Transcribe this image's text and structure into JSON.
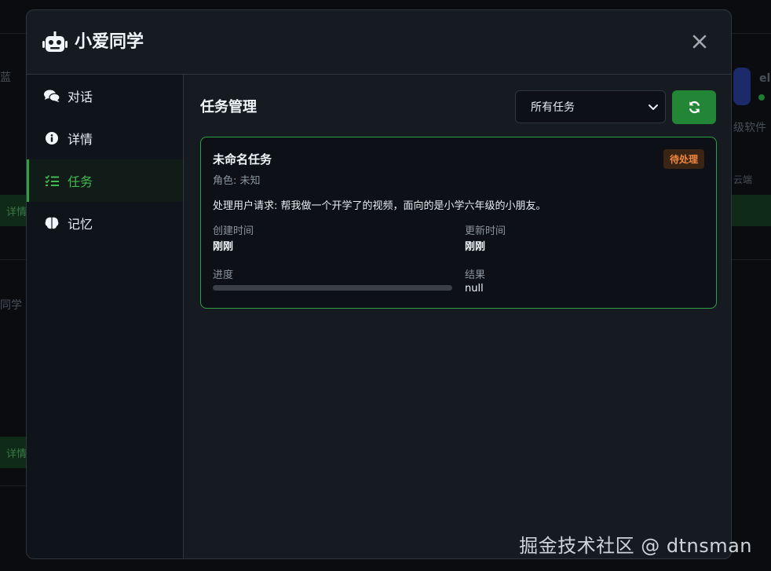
{
  "app": {
    "title": "小爱同学"
  },
  "sidebar": {
    "items": [
      {
        "label": "对话",
        "icon": "comments-icon",
        "active": false
      },
      {
        "label": "详情",
        "icon": "info-circle-icon",
        "active": false
      },
      {
        "label": "任务",
        "icon": "task-list-icon",
        "active": true
      },
      {
        "label": "记忆",
        "icon": "brain-icon",
        "active": false
      }
    ]
  },
  "tasks_panel": {
    "title": "任务管理",
    "filter": {
      "selected": "所有任务"
    },
    "refresh_icon": "refresh-icon",
    "cards": [
      {
        "name": "未命名任务",
        "role": "角色: 未知",
        "status": "待处理",
        "description": "处理用户请求: 帮我做一个开学了的视频，面向的是小学六年级的小朋友。",
        "created_label": "创建时间",
        "created_value": "刚刚",
        "updated_label": "更新时间",
        "updated_value": "刚刚",
        "progress_label": "进度",
        "progress_percent": 0,
        "result_label": "结果",
        "result_value": "null"
      }
    ]
  },
  "background": {
    "fragments": [
      "蓝",
      "详情",
      "同学",
      "详情",
      "el",
      "级软件",
      "云端"
    ]
  },
  "watermark": "掘金技术社区 @ dtnsman",
  "colors": {
    "accent_green": "#2ea043",
    "status_orange": "#f0883e",
    "modal_bg": "#161b22",
    "card_bg": "#0d1117"
  }
}
